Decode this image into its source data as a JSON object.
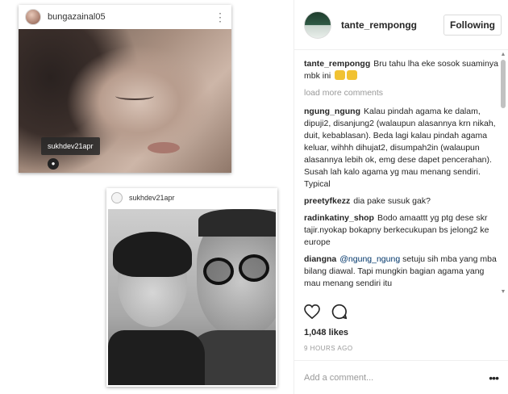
{
  "post1": {
    "username": "bungazainal05",
    "tag_label": "sukhdev21apr"
  },
  "post2": {
    "username": "sukhdev21apr"
  },
  "panel": {
    "username": "tante_rempongg",
    "follow_label": "Following",
    "caption": {
      "user": "tante_rempongg",
      "text": "Bru tahu lha eke sosok suaminya mbk ini"
    },
    "load_more": "load more comments",
    "comments": [
      {
        "user": "ngung_ngung",
        "text": "Kalau pindah agama ke dalam, dipuji2, disanjung2 (walaupun alasannya krn nikah, duit, kebablasan). Beda lagi kalau pindah agama keluar, wihhh dihujat2, disumpah2in (walaupun alasannya lebih ok, emg dese dapet pencerahan). Susah lah kalo agama yg mau menang sendiri. Typical"
      },
      {
        "user": "preetyfkezz",
        "text": "dia pake susuk gak?"
      },
      {
        "user": "radinkatiny_shop",
        "text": "Bodo amaattt yg ptg dese skr tajir.nyokap bokapny berkecukupan bs jelong2 ke europe"
      },
      {
        "user": "diangna",
        "mention": "@ngung_ngung",
        "text": "setuju sih mba yang mba bilang diawal. Tapi mungkin bagian agama yang mau menang sendiri itu"
      }
    ],
    "likes": "1,048 likes",
    "time_ago": "9 HOURS AGO",
    "add_comment_placeholder": "Add a comment..."
  },
  "icons": {
    "more": "more-options-icon",
    "heart": "heart-icon",
    "comment": "comment-icon",
    "user_tag": "user-tag-icon"
  }
}
